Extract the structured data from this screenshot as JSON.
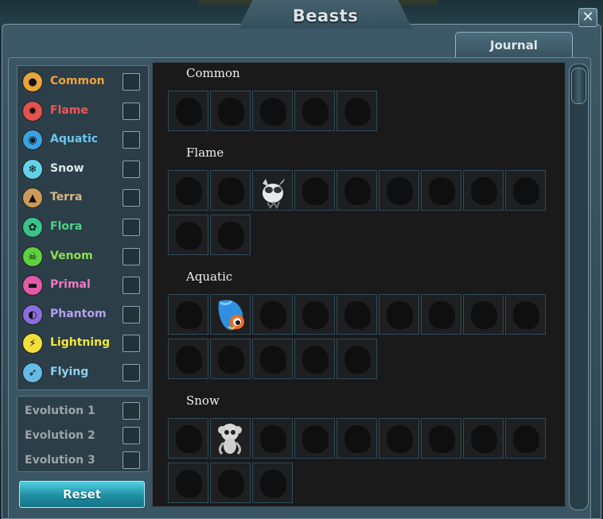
{
  "window": {
    "title": "Beasts",
    "close_glyph": "✕",
    "tab_label": "Journal"
  },
  "filters": [
    {
      "label": "Common",
      "color": "#f0a23c",
      "icon": "common-icon",
      "icon_bg": "#e8a53a",
      "glyph": "●"
    },
    {
      "label": "Flame",
      "color": "#e65a5a",
      "icon": "flame-icon",
      "icon_bg": "#e2524e",
      "glyph": "✹"
    },
    {
      "label": "Aquatic",
      "color": "#6cc6f0",
      "icon": "aquatic-icon",
      "icon_bg": "#3aa2e0",
      "glyph": "◉"
    },
    {
      "label": "Snow",
      "color": "#dfe8ee",
      "icon": "snow-icon",
      "icon_bg": "#62d2e8",
      "glyph": "❄"
    },
    {
      "label": "Terra",
      "color": "#d7b68c",
      "icon": "terra-icon",
      "icon_bg": "#c99a5a",
      "glyph": "▲"
    },
    {
      "label": "Flora",
      "color": "#4ed28a",
      "icon": "flora-icon",
      "icon_bg": "#38c28e",
      "glyph": "✿"
    },
    {
      "label": "Venom",
      "color": "#8ee04e",
      "icon": "venom-icon",
      "icon_bg": "#5ed23e",
      "glyph": "☠"
    },
    {
      "label": "Primal",
      "color": "#ec7ac0",
      "icon": "primal-icon",
      "icon_bg": "#e25aa8",
      "glyph": "▬"
    },
    {
      "label": "Phantom",
      "color": "#b7a0f0",
      "icon": "phantom-icon",
      "icon_bg": "#8a6ee0",
      "glyph": "◐"
    },
    {
      "label": "Lightning",
      "color": "#f2e640",
      "icon": "lightning-icon",
      "icon_bg": "#f2e03a",
      "glyph": "⚡"
    },
    {
      "label": "Flying",
      "color": "#8cd0f0",
      "icon": "flying-icon",
      "icon_bg": "#64bce6",
      "glyph": "➶"
    }
  ],
  "evolutions": [
    {
      "label": "Evolution 1"
    },
    {
      "label": "Evolution 2"
    },
    {
      "label": "Evolution 3"
    }
  ],
  "reset_label": "Reset",
  "sections": [
    {
      "title": "Common",
      "count": 5,
      "revealed": []
    },
    {
      "title": "Flame",
      "count": 11,
      "revealed": [
        2
      ]
    },
    {
      "title": "Aquatic",
      "count": 14,
      "revealed": [
        1
      ]
    },
    {
      "title": "Snow",
      "count": 12,
      "revealed": [
        1
      ]
    }
  ]
}
